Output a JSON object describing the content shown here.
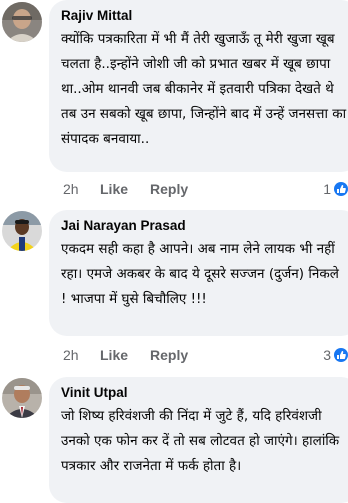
{
  "comments": [
    {
      "author": "Rajiv Mittal",
      "text": "क्योंकि पत्रकारिता में भी मैं तेरी खुजाऊँ तू मेरी खुजा खूब चलता है..इन्होंने जोशी जी को प्रभात खबर में खूब छापा था..ओम थानवी जब बीकानेर में इतवारी पत्रिका देखते थे तब उन सबको खूब छापा, जिन्होंने बाद में उन्हें जनसत्ता का संपादक बनवाया..",
      "time": "2h",
      "like_label": "Like",
      "reply_label": "Reply",
      "reaction_count": "1",
      "avatar_icon": "avatar-man-icon"
    },
    {
      "author": "Jai Narayan Prasad",
      "text": "एकदम सही कहा है आपने। अब नाम लेने लायक भी नहीं रहा। एमजे अकबर के बाद ये दूसरे सज्जन (दुर्जन) निकले ! भाजपा में घुसे बिचौलिए !!!",
      "time": "2h",
      "like_label": "Like",
      "reply_label": "Reply",
      "reaction_count": "3",
      "avatar_icon": "avatar-man-yellow-icon"
    },
    {
      "author": "Vinit Utpal",
      "text": "जो शिष्य हरिवंशजी की निंदा में जुटे हैं, यदि हरिवंशजी उनको एक फोन कर दें तो सब लोटवत हो जाएंगे। हालांकि पत्रकार और राजनेता में फर्क होता है।",
      "avatar_icon": "avatar-man-suit-icon"
    }
  ],
  "colors": {
    "bubble": "#f0f2f5",
    "meta": "#65676b",
    "like_blue": "#1877f2"
  }
}
